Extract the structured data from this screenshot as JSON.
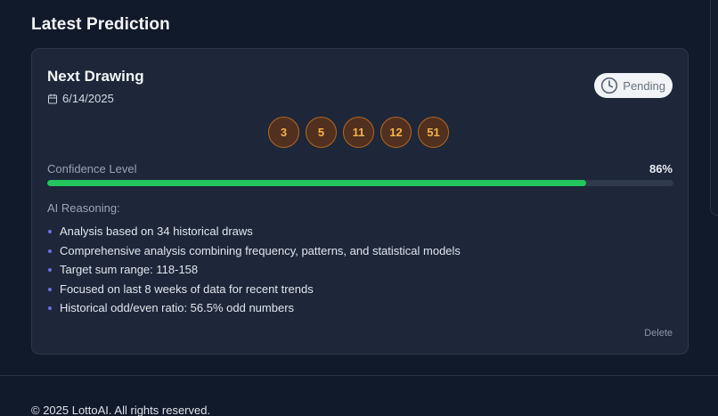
{
  "section": {
    "title": "Latest Prediction"
  },
  "card": {
    "title": "Next Drawing",
    "date": "6/14/2025",
    "status": "Pending",
    "numbers": [
      "3",
      "5",
      "11",
      "12",
      "51"
    ],
    "confidence": {
      "label": "Confidence Level",
      "value_text": "86%",
      "percent": 86
    },
    "reasoning": {
      "label": "AI Reasoning:",
      "items": [
        "Analysis based on 34 historical draws",
        "Comprehensive analysis combining frequency, patterns, and statistical models",
        "Target sum range: 118-158",
        "Focused on last 8 weeks of data for recent trends",
        "Historical odd/even ratio: 56.5% odd numbers"
      ]
    },
    "delete_label": "Delete"
  },
  "footer": {
    "copyright": "© 2025 LottoAI. All rights reserved."
  },
  "icons": {
    "date": "calendar-icon",
    "status": "clock-icon"
  },
  "colors": {
    "progress": "#22c55e",
    "ball_text": "#f4b24a",
    "bullet": "#6b6fe3"
  }
}
